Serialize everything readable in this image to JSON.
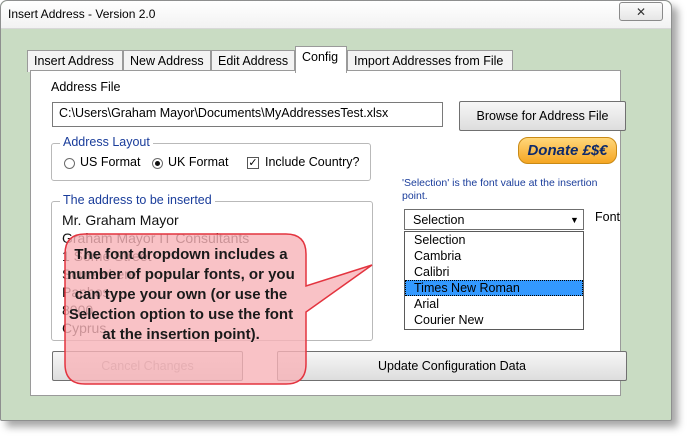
{
  "window": {
    "title": "Insert Address - Version 2.0",
    "close_glyph": "✕"
  },
  "tabs": [
    {
      "label": "Insert Address",
      "active": false
    },
    {
      "label": "New Address",
      "active": false
    },
    {
      "label": "Edit Address",
      "active": false
    },
    {
      "label": "Config",
      "active": true
    },
    {
      "label": "Import Addresses from File",
      "active": false
    }
  ],
  "address_file": {
    "label": "Address File",
    "value": "C:\\Users\\Graham Mayor\\Documents\\MyAddressesTest.xlsx",
    "browse_label": "Browse for Address File"
  },
  "donate": {
    "label": "Donate £$€"
  },
  "layout": {
    "title": "Address Layout",
    "us_label": "US Format",
    "us_selected": false,
    "uk_label": "UK Format",
    "uk_selected": true,
    "include_country_label": "Include Country?",
    "include_country_checked": true
  },
  "address": {
    "title": "The address to be inserted",
    "lines": [
      "Mr. Graham Mayor",
      "Graham Mayor IT Consultants",
      "1 Some Street",
      "Somewhere",
      "Paphos",
      "8000",
      "Cyprus"
    ]
  },
  "font": {
    "note": "'Selection' is the font value at the insertion point.",
    "label": "Font",
    "value": "Selection",
    "options": [
      "Selection",
      "Cambria",
      "Calibri",
      "Times New Roman",
      "Arial",
      "Courier New"
    ],
    "highlighted": "Times New Roman"
  },
  "buttons": {
    "cancel": "Cancel Changes",
    "update": "Update Configuration Data"
  },
  "callout": {
    "text": "The font dropdown includes a number of popular fonts, or you can type your own (or use the Selection option to use the font at the insertion point).",
    "fill": "#f8b3b8",
    "stroke": "#e3343f"
  },
  "colors": {
    "window_bg": "#c9dcc3",
    "group_title": "#1a3d9b",
    "list_highlight": "#3399ff"
  }
}
